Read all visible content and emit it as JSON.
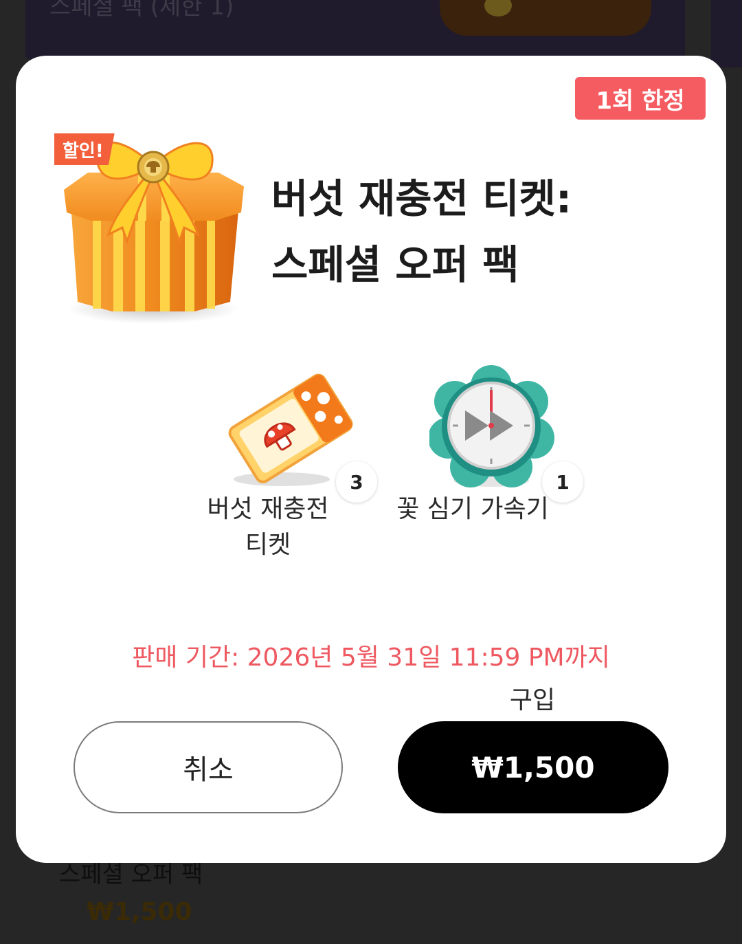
{
  "background": {
    "top_item_text": "스페셜 팩 (제한 1)",
    "bottom_item_name": "스페셜 오퍼 팩",
    "bottom_item_price": "₩1,500"
  },
  "modal": {
    "limit_badge": "1회 한정",
    "sale_tag": "할인!",
    "title_line1": "버섯 재충전 티켓:",
    "title_line2": "스페셜 오퍼 팩",
    "items": [
      {
        "label_line1": "버섯 재충전",
        "label_line2": "티켓",
        "quantity": "3",
        "icon": "mushroom-ticket-icon"
      },
      {
        "label_line1": "꽃 심기 가속기",
        "label_line2": "",
        "quantity": "1",
        "icon": "speed-clock-icon"
      }
    ],
    "sale_period": "판매 기간: 2026년 5월 31일 11:59 PM까지",
    "buy_label": "구입",
    "cancel_button": "취소",
    "price_button": "₩1,500"
  },
  "colors": {
    "accent_red": "#f55c61",
    "period_text": "#ee5860",
    "buy_button": "#000000"
  }
}
